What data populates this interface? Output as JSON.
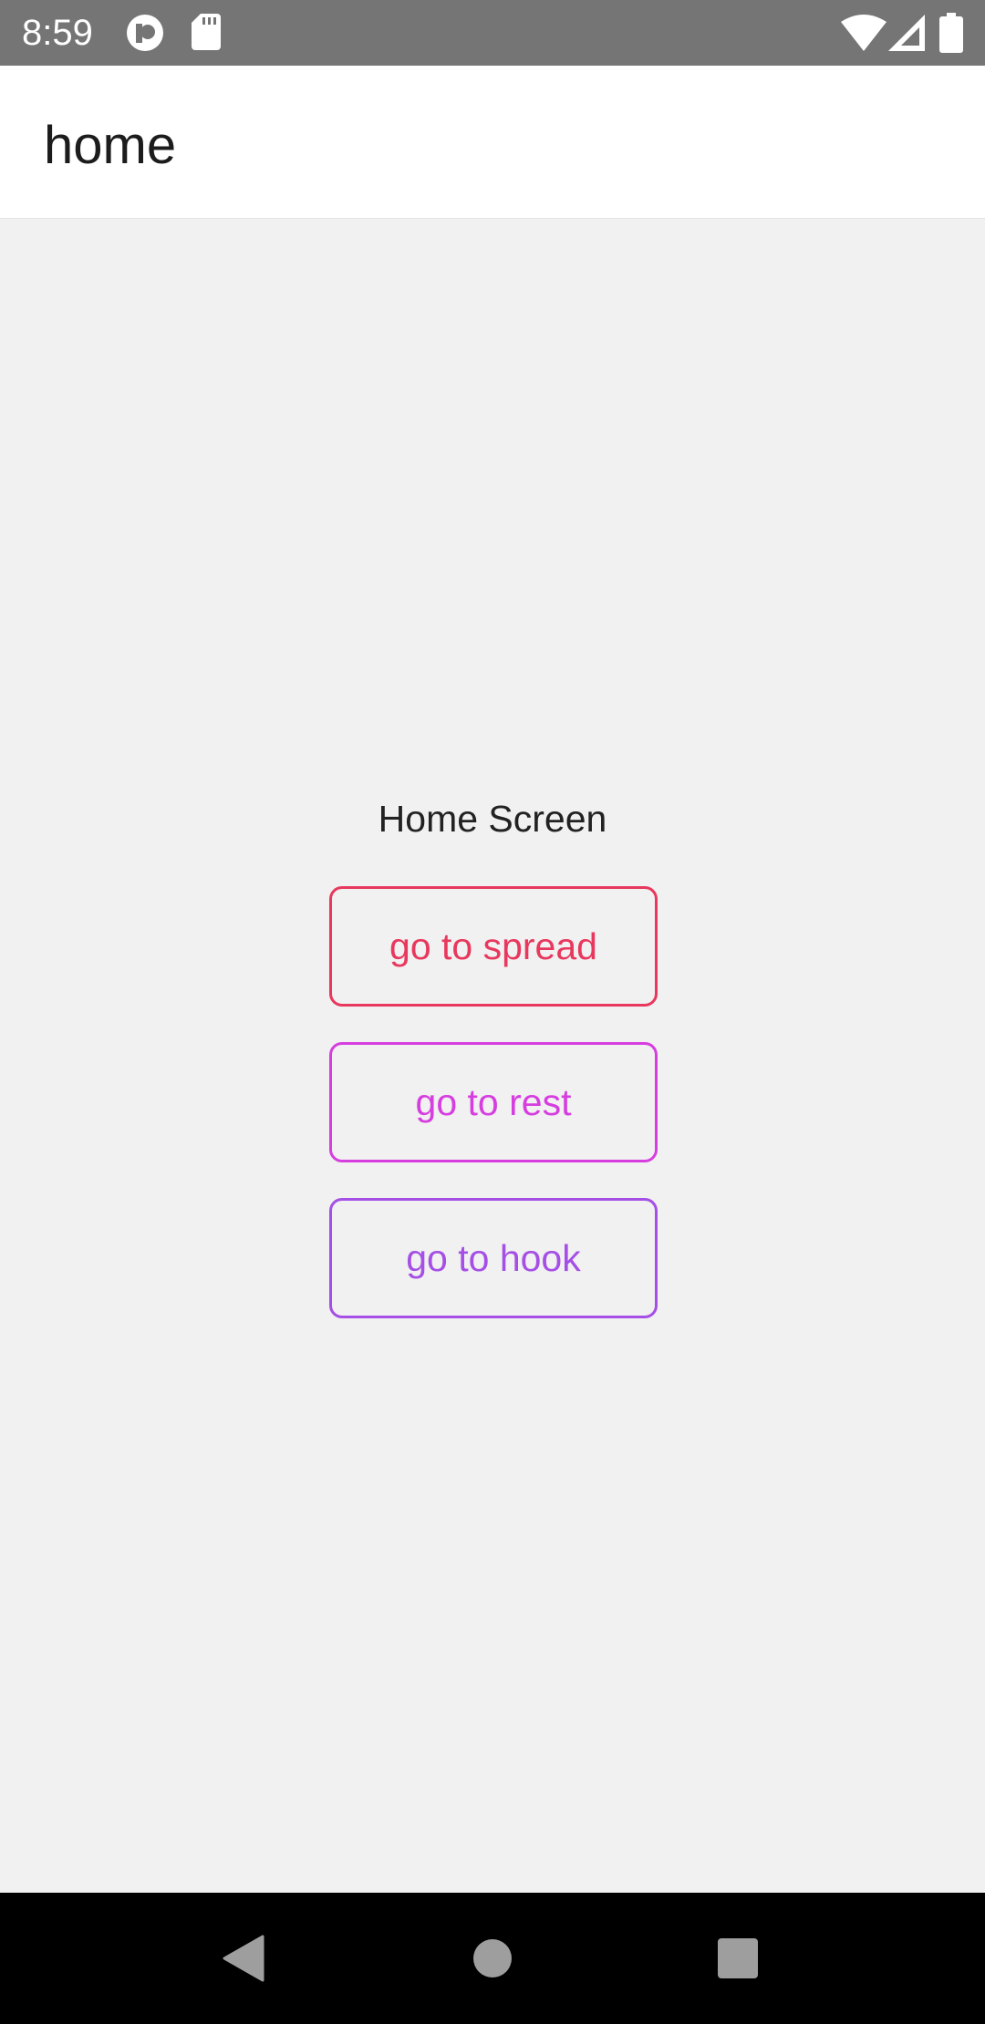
{
  "status_bar": {
    "time": "8:59",
    "icons": [
      "app-notification-icon",
      "sd-card-icon",
      "wifi-icon",
      "cell-signal-icon",
      "battery-icon"
    ]
  },
  "app_bar": {
    "title": "home"
  },
  "main": {
    "label": "Home Screen",
    "buttons": [
      {
        "label": "go to spread",
        "color": "#e8385e"
      },
      {
        "label": "go to rest",
        "color": "#d63ee0"
      },
      {
        "label": "go to hook",
        "color": "#a54fe6"
      }
    ]
  },
  "nav_bar": {
    "icons": [
      "back-icon",
      "home-icon",
      "recents-icon"
    ]
  }
}
